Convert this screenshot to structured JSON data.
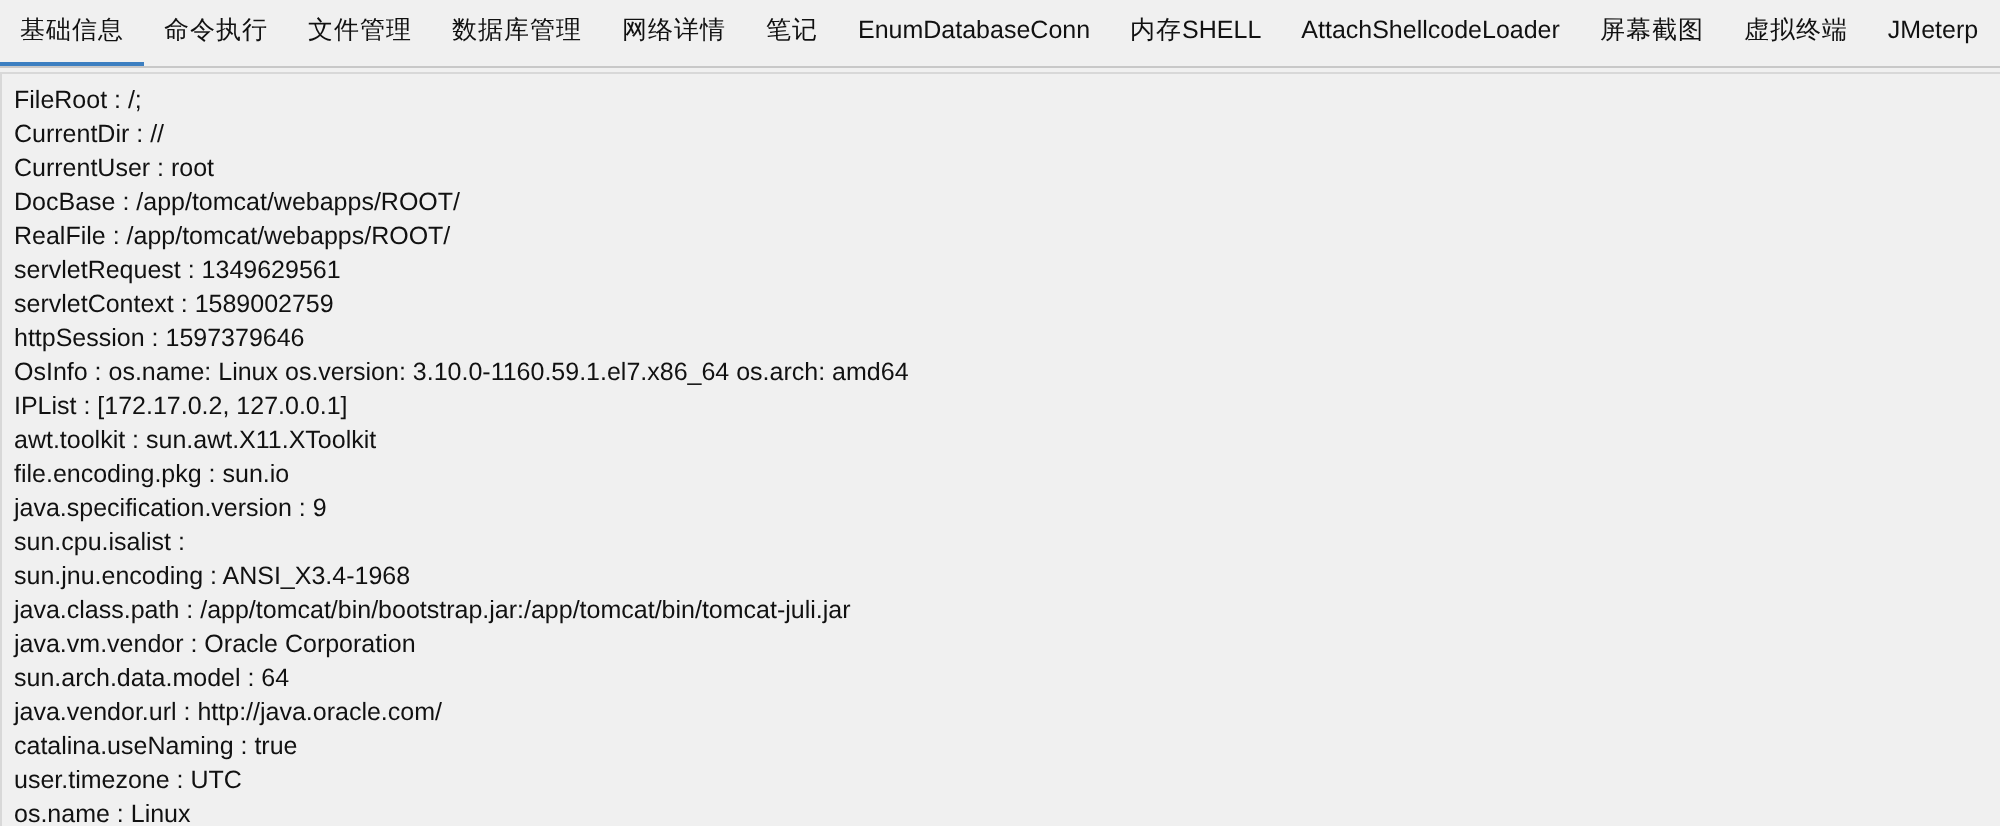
{
  "tabs": [
    {
      "label": "基础信息",
      "selected": true
    },
    {
      "label": "命令执行",
      "selected": false
    },
    {
      "label": "文件管理",
      "selected": false
    },
    {
      "label": "数据库管理",
      "selected": false
    },
    {
      "label": "网络详情",
      "selected": false
    },
    {
      "label": "笔记",
      "selected": false
    },
    {
      "label": "EnumDatabaseConn",
      "selected": false
    },
    {
      "label": "内存SHELL",
      "selected": false
    },
    {
      "label": "AttachShellcodeLoader",
      "selected": false
    },
    {
      "label": "屏幕截图",
      "selected": false
    },
    {
      "label": "虚拟终端",
      "selected": false
    },
    {
      "label": "JMeterp",
      "selected": false
    }
  ],
  "info_lines": [
    "FileRoot : /;",
    "CurrentDir : //",
    "CurrentUser : root",
    "DocBase : /app/tomcat/webapps/ROOT/",
    "RealFile : /app/tomcat/webapps/ROOT/",
    "servletRequest : 1349629561",
    "servletContext : 1589002759",
    "httpSession : 1597379646",
    "OsInfo : os.name: Linux os.version: 3.10.0-1160.59.1.el7.x86_64 os.arch: amd64",
    "IPList : [172.17.0.2, 127.0.0.1]",
    "awt.toolkit : sun.awt.X11.XToolkit",
    "file.encoding.pkg : sun.io",
    "java.specification.version : 9",
    "sun.cpu.isalist :",
    "sun.jnu.encoding : ANSI_X3.4-1968",
    "java.class.path : /app/tomcat/bin/bootstrap.jar:/app/tomcat/bin/tomcat-juli.jar",
    "java.vm.vendor : Oracle Corporation",
    "sun.arch.data.model : 64",
    "java.vendor.url : http://java.oracle.com/",
    "catalina.useNaming : true",
    "user.timezone : UTC",
    "os.name : Linux"
  ]
}
